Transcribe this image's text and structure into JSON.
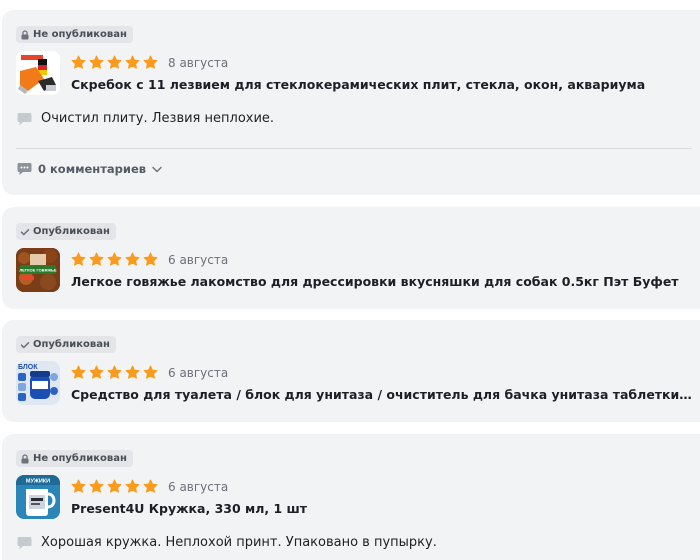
{
  "icons": {
    "lock": "lock-icon",
    "check": "check-icon",
    "star": "star-icon",
    "message": "message-icon",
    "chevron": "chevron-down-icon"
  },
  "colors": {
    "star": "#fb9b1b",
    "card_bg": "#f2f3f5",
    "badge_bg": "#e3e5e9"
  },
  "reviews": [
    {
      "status": "Не опубликован",
      "rating": 5,
      "date": "8 августа",
      "product_title": "Скребок с 11 лезвием для стеклокерамических плит, стекла, окон, аквариума",
      "text": "Очистил плиту. Лезвия неплохие.",
      "comments_label": "0 комментариев"
    },
    {
      "status": "Опубликован",
      "rating": 5,
      "date": "6 августа",
      "product_title": "Легкое говяжье лакомство для дрессировки вкусняшки для собак 0.5кг Пэт Буфет",
      "thumb_text": "ЛЕГКОЕ ГОВЯЖЬЕ"
    },
    {
      "status": "Опубликован",
      "rating": 5,
      "date": "6 августа",
      "product_title": "Средство для туалета / блок для унитаза / очиститель для бачка унитаза таблетки…",
      "thumb_text": "БЛОК"
    },
    {
      "status": "Не опубликован",
      "rating": 5,
      "date": "6 августа",
      "product_title": "Present4U Кружка, 330 мл, 1 шт",
      "text": "Хорошая кружка. Неплохой принт. Упаковано в пупырку.",
      "thumb_text": "МУЖИКИ"
    }
  ]
}
